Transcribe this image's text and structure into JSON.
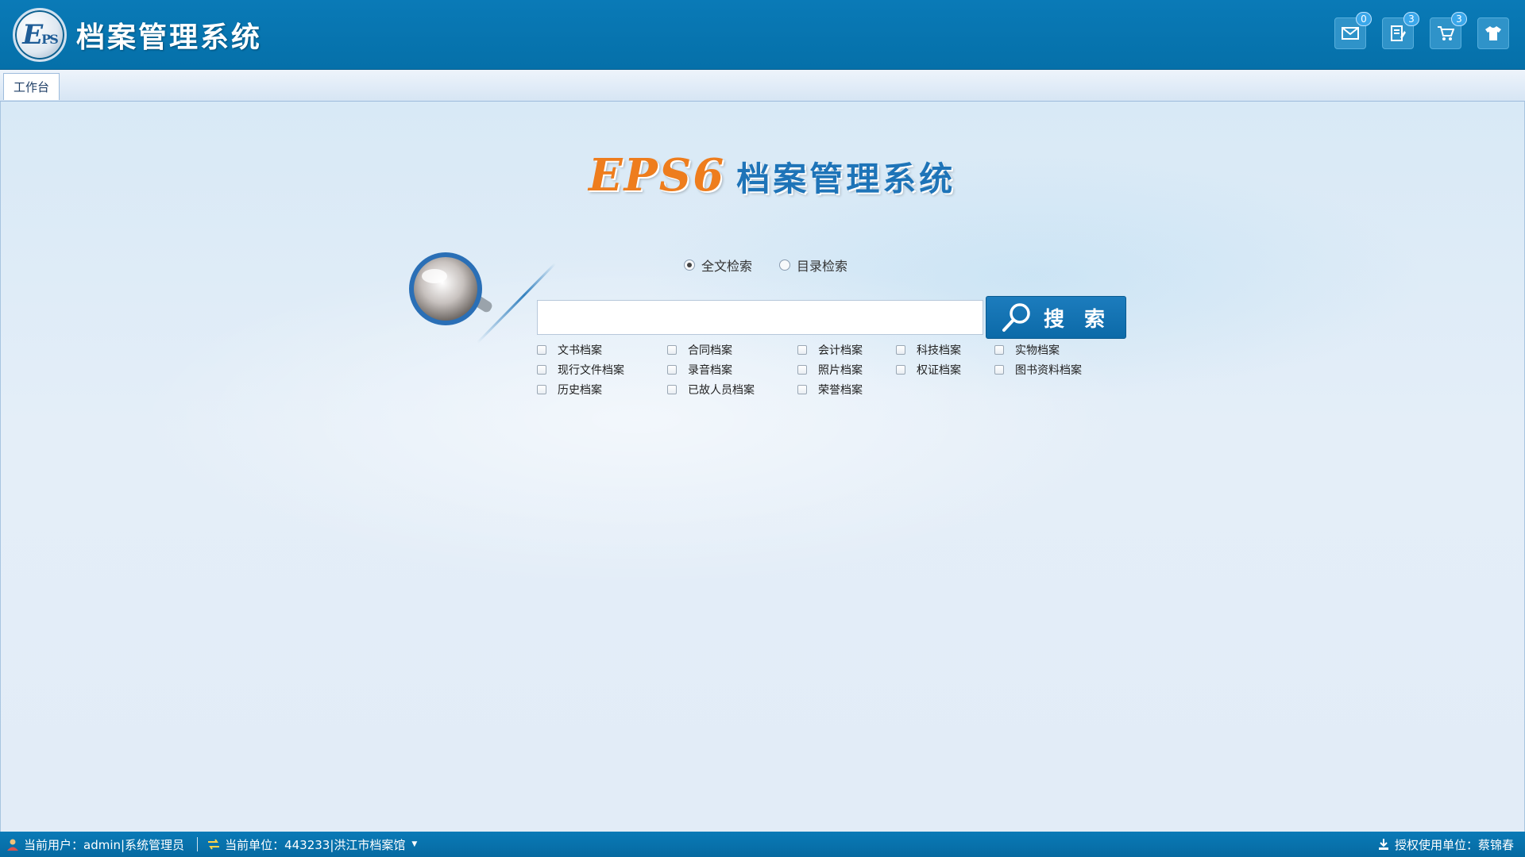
{
  "header": {
    "logo_mark": "E",
    "logo_mark_small": "PS",
    "app_title": "档案管理系统",
    "buttons": [
      {
        "name": "mail",
        "icon": "mail-icon",
        "badge": "0"
      },
      {
        "name": "tasks",
        "icon": "document-edit-icon",
        "badge": "3"
      },
      {
        "name": "cart",
        "icon": "cart-icon",
        "badge": "3"
      },
      {
        "name": "skin",
        "icon": "shirt-icon",
        "badge": ""
      }
    ]
  },
  "tabs": [
    {
      "label": "工作台",
      "active": true
    }
  ],
  "main": {
    "brand_eps": "EPS6",
    "brand_cn": "档案管理系统",
    "search_modes": [
      {
        "label": "全文检索",
        "checked": true
      },
      {
        "label": "目录检索",
        "checked": false
      }
    ],
    "search_input": {
      "value": "",
      "placeholder": ""
    },
    "search_button_label": "搜 索",
    "categories": [
      "文书档案",
      "合同档案",
      "会计档案",
      "科技档案",
      "实物档案",
      "现行文件档案",
      "录音档案",
      "照片档案",
      "权证档案",
      "图书资料档案",
      "历史档案",
      "已故人员档案",
      "荣誉档案"
    ]
  },
  "statusbar": {
    "current_user": "当前用户：admin|系统管理员",
    "current_unit": "当前单位：443233|洪江市档案馆",
    "licensed_unit": "授权使用单位：蔡锦春"
  },
  "colors": {
    "header_bg": "#0570a9",
    "brand_orange": "#ee7d1d",
    "brand_blue": "#1e74b8",
    "button_blue": "#0c6aa8"
  }
}
